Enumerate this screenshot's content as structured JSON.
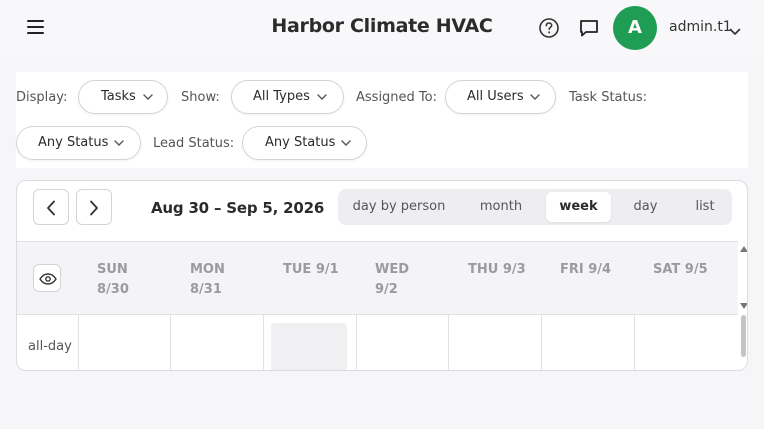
{
  "header": {
    "title": "Harbor Climate HVAC",
    "avatar_initial": "A",
    "avatar_color": "#1f9d55",
    "username": "admin.t1",
    "icons": [
      "menu-icon",
      "help-icon",
      "chat-icon",
      "chevron-down-icon"
    ]
  },
  "filters": {
    "display_label": "Display:",
    "display_value": "Tasks",
    "show_label": "Show:",
    "show_value": "All Types",
    "assigned_label": "Assigned To:",
    "assigned_value": "All Users",
    "task_status_label": "Task Status:",
    "task_status_value": "Any Status",
    "lead_status_label": "Lead Status:",
    "lead_status_value": "Any Status"
  },
  "calendar": {
    "range": "Aug 30 – Sep 5, 2026",
    "views": [
      "day by person",
      "month",
      "week",
      "day",
      "list"
    ],
    "active_view": "week",
    "days": [
      {
        "line1": "SUN",
        "line2": "8/30"
      },
      {
        "line1": "MON",
        "line2": "8/31"
      },
      {
        "line1": "TUE 9/1",
        "line2": ""
      },
      {
        "line1": "WED",
        "line2": "9/2"
      },
      {
        "line1": "THU 9/3",
        "line2": ""
      },
      {
        "line1": "FRI 9/4",
        "line2": ""
      },
      {
        "line1": "SAT 9/5",
        "line2": ""
      }
    ],
    "allday_label": "all-day",
    "today_index": 2
  }
}
